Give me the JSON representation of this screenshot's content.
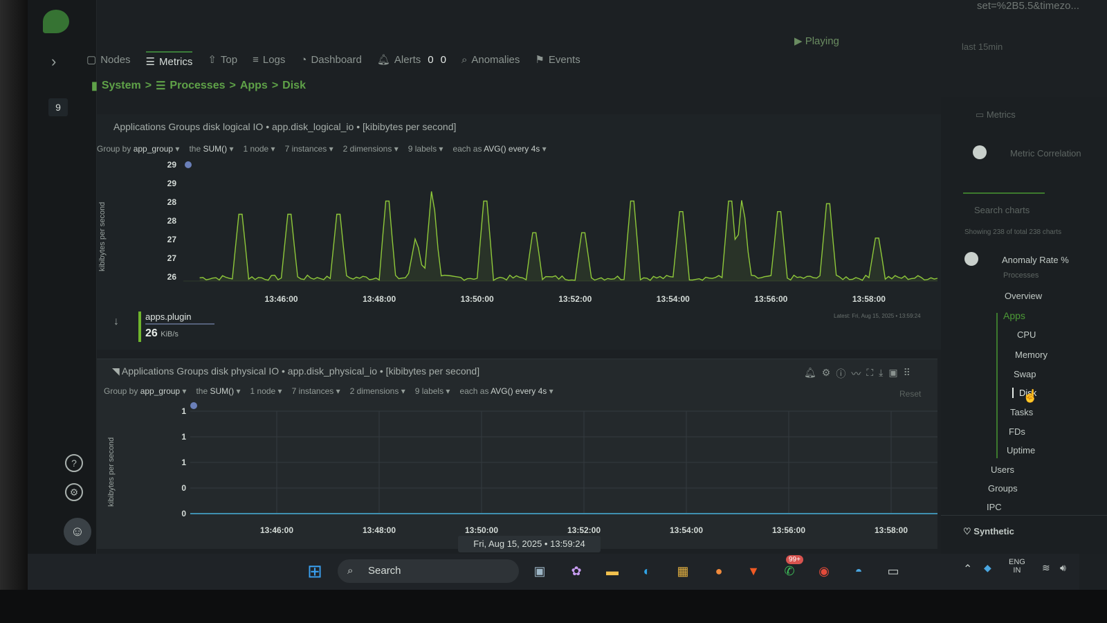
{
  "window": {
    "url_fragment": "set=%2B5.5&timezo...",
    "playing": "Playing",
    "last_time": "last 15min"
  },
  "rail": {
    "badge": "9"
  },
  "nav": {
    "tabs": [
      "Nodes",
      "Metrics",
      "Top",
      "Logs",
      "Dashboard",
      "Alerts",
      "Anomalies",
      "Events"
    ],
    "alert_counts": [
      "0",
      "0"
    ]
  },
  "breadcrumb": [
    "System",
    "Processes",
    "Apps",
    "Disk"
  ],
  "chart1": {
    "title": "Applications Groups disk logical IO • app.disk_logical_io • [kibibytes per second]",
    "filters": {
      "group_by_label": "Group by",
      "group_by": "app_group",
      "agg_label": "the",
      "agg": "SUM()",
      "nodes": "1 node",
      "instances": "7 instances",
      "dimensions": "2 dimensions",
      "labels": "9 labels",
      "each_label": "each as",
      "each": "AVG() every 4s"
    },
    "ylabel": "kibibytes per second",
    "legend_name": "apps.plugin",
    "legend_value": "26",
    "legend_unit": "KiB/s",
    "latest": "Latest: Fri, Aug 15, 2025 • 13:59:24"
  },
  "chart2": {
    "title": "Applications Groups disk physical IO • app.disk_physical_io • [kibibytes per second]",
    "filters": {
      "group_by_label": "Group by",
      "group_by": "app_group",
      "agg_label": "the",
      "agg": "SUM()",
      "nodes": "1 node",
      "instances": "7 instances",
      "dimensions": "2 dimensions",
      "labels": "9 labels",
      "each_label": "each as",
      "each": "AVG() every 4s"
    },
    "ylabel": "kibibytes per second",
    "reset": "Reset",
    "timestamp": "Fri, Aug 15, 2025 • 13:59:24"
  },
  "chart_data": [
    {
      "type": "line",
      "title": "Applications Groups disk logical IO • app.disk_logical_io • [kibibytes per second]",
      "ylabel": "kibibytes per second",
      "yticks": [
        "29",
        "29",
        "28",
        "28",
        "27",
        "27",
        "26"
      ],
      "ylim": [
        26,
        29.6
      ],
      "xticks": [
        "13:46:00",
        "13:48:00",
        "13:50:00",
        "13:52:00",
        "13:54:00",
        "13:56:00",
        "13:58:00"
      ],
      "xlim": [
        "13:44:00",
        "13:59:24"
      ],
      "series": [
        {
          "name": "apps.plugin",
          "color": "#8fc93a",
          "baseline": 26.1,
          "spikes": [
            {
              "x": "13:45:10",
              "y": 28.5
            },
            {
              "x": "13:46:10",
              "y": 28.5
            },
            {
              "x": "13:47:10",
              "y": 28.5
            },
            {
              "x": "13:48:10",
              "y": 29.0
            },
            {
              "x": "13:48:45",
              "y": 27.4
            },
            {
              "x": "13:49:05",
              "y": 29.0
            },
            {
              "x": "13:50:10",
              "y": 29.0
            },
            {
              "x": "13:51:10",
              "y": 27.8
            },
            {
              "x": "13:52:10",
              "y": 27.8
            },
            {
              "x": "13:53:10",
              "y": 29.0
            },
            {
              "x": "13:54:10",
              "y": 28.6
            },
            {
              "x": "13:55:10",
              "y": 29.0
            },
            {
              "x": "13:55:25",
              "y": 28.7
            },
            {
              "x": "13:56:10",
              "y": 28.6
            },
            {
              "x": "13:57:10",
              "y": 28.9
            },
            {
              "x": "13:58:10",
              "y": 27.6
            }
          ]
        }
      ]
    },
    {
      "type": "line",
      "title": "Applications Groups disk physical IO • app.disk_physical_io • [kibibytes per second]",
      "ylabel": "kibibytes per second",
      "yticks": [
        "1",
        "1",
        "1",
        "0",
        "0"
      ],
      "ylim": [
        0,
        1
      ],
      "xticks": [
        "13:46:00",
        "13:48:00",
        "13:50:00",
        "13:52:00",
        "13:54:00",
        "13:56:00",
        "13:58:00"
      ],
      "series": [
        {
          "color": "#3f8fb0",
          "values": [
            0,
            0
          ]
        }
      ]
    }
  ],
  "sidebar": {
    "metrics": "Metrics",
    "metric_correlation": "Metric Correlation",
    "search_placeholder": "Search charts",
    "showing": "Showing 238 of total 238 charts",
    "anomaly_rate": "Anomaly Rate %",
    "processes": "Processes",
    "overview": "Overview",
    "apps": "Apps",
    "apps_items": [
      "CPU",
      "Memory",
      "Swap",
      "Disk",
      "Tasks",
      "FDs",
      "Uptime"
    ],
    "users": "Users",
    "groups": "Groups",
    "ipc": "IPC",
    "synthetic": "Synthetic"
  },
  "taskbar": {
    "search": "Search",
    "badge": "99+",
    "lang": "ENG",
    "region": "IN"
  }
}
